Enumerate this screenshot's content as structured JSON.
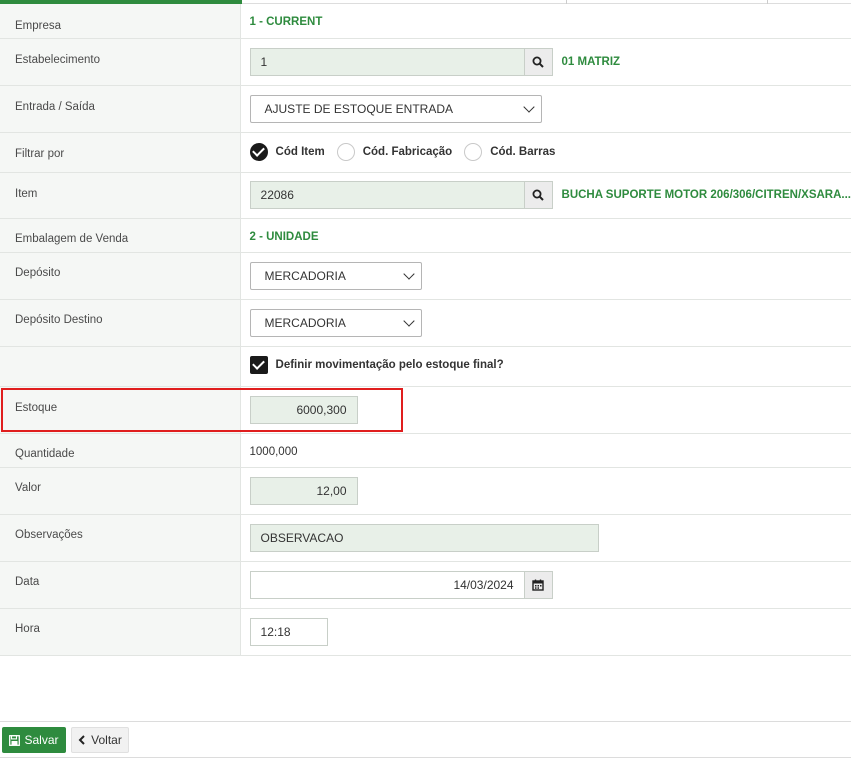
{
  "form": {
    "empresa": {
      "label": "Empresa",
      "value": "1 - CURRENT"
    },
    "estabelecimento": {
      "label": "Estabelecimento",
      "value": "1",
      "description": "01 MATRIZ",
      "search_icon": "search-icon"
    },
    "entrada_saida": {
      "label": "Entrada / Saída",
      "selected": "AJUSTE DE ESTOQUE ENTRADA"
    },
    "filtrar_por": {
      "label": "Filtrar por",
      "options": [
        {
          "label": "Cód Item",
          "checked": true
        },
        {
          "label": "Cód. Fabricação",
          "checked": false
        },
        {
          "label": "Cód. Barras",
          "checked": false
        }
      ]
    },
    "item": {
      "label": "Item",
      "value": "22086",
      "description": "BUCHA SUPORTE MOTOR 206/306/CITREN/XSARA..."
    },
    "embalagem": {
      "label": "Embalagem de Venda",
      "value": "2 - UNIDADE"
    },
    "deposito": {
      "label": "Depósito",
      "selected": "MERCADORIA"
    },
    "deposito_destino": {
      "label": "Depósito Destino",
      "selected": "MERCADORIA"
    },
    "definir_mov": {
      "label": "Definir movimentação pelo estoque final?",
      "checked": true
    },
    "estoque": {
      "label": "Estoque",
      "value": "6000,300"
    },
    "quantidade": {
      "label": "Quantidade",
      "value": "1000,000"
    },
    "valor": {
      "label": "Valor",
      "value": "12,00"
    },
    "observacoes": {
      "label": "Observações",
      "value": "OBSERVACAO"
    },
    "data": {
      "label": "Data",
      "value": "14/03/2024",
      "icon": "calendar-icon"
    },
    "hora": {
      "label": "Hora",
      "value": "12:18"
    }
  },
  "footer": {
    "save_label": "Salvar",
    "back_label": "Voltar"
  },
  "colors": {
    "accent_green": "#2e8b3e",
    "highlight_red": "#e01e1e",
    "field_bg": "#e8f0e8"
  }
}
